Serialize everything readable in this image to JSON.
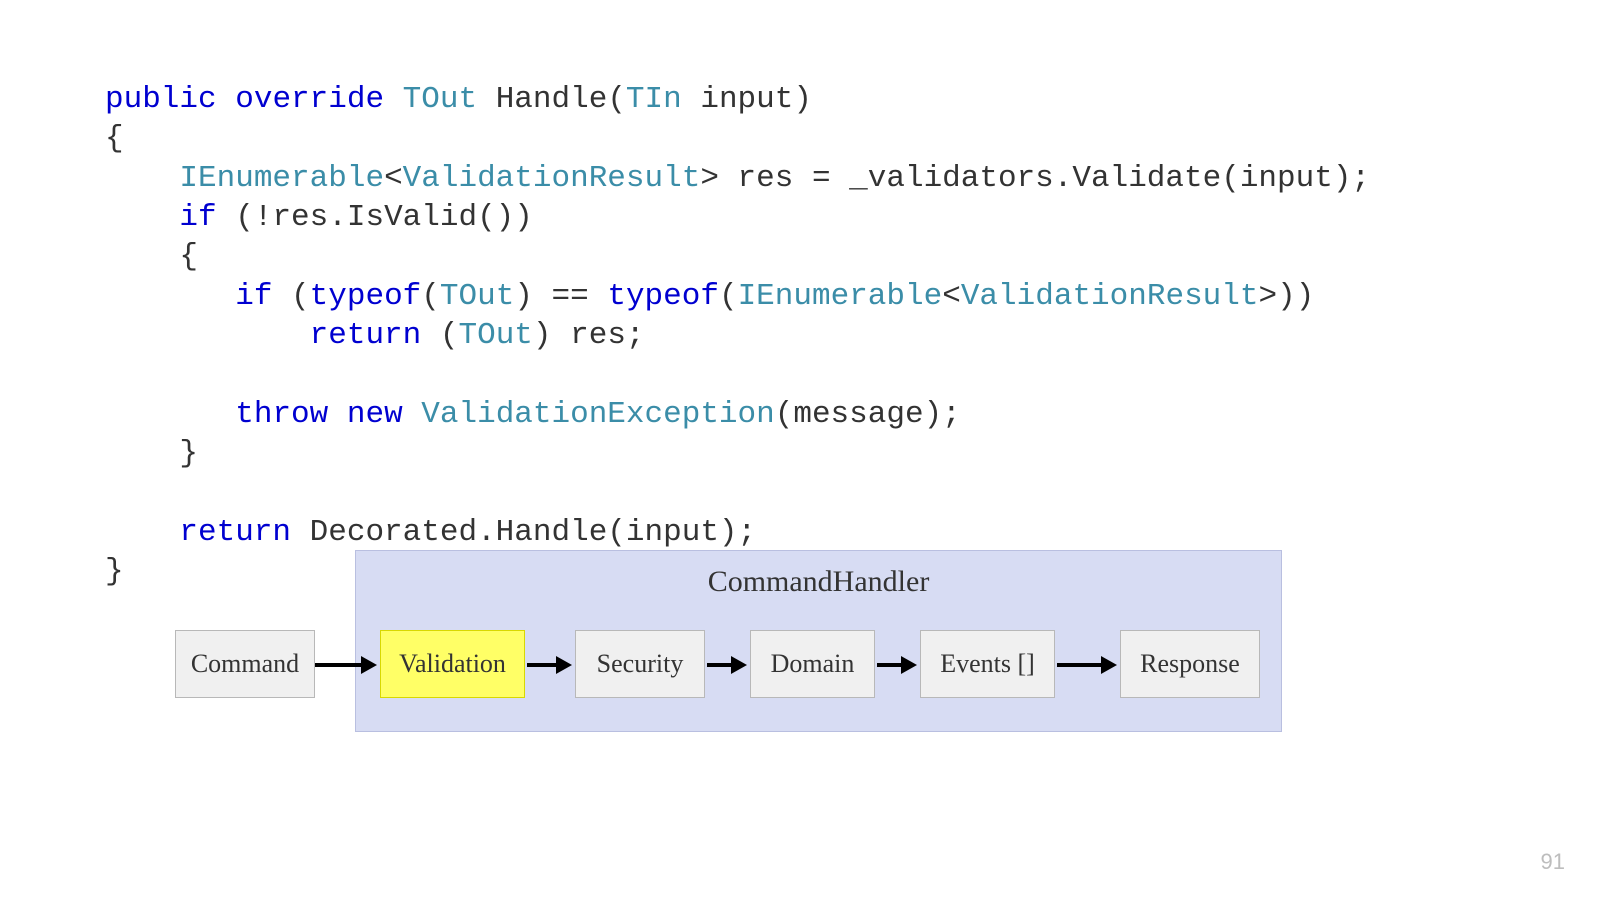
{
  "code": {
    "line1_a": "public",
    "line1_b": " ",
    "line1_c": "override",
    "line1_d": " ",
    "line1_e": "TOut",
    "line1_f": " Handle(",
    "line1_g": "TIn",
    "line1_h": " input)",
    "line2": "{",
    "line3_a": "    ",
    "line3_b": "IEnumerable",
    "line3_c": "<",
    "line3_d": "ValidationResult",
    "line3_e": "> res = _validators.Validate(input);",
    "line4_a": "    ",
    "line4_b": "if",
    "line4_c": " (!res.IsValid())",
    "line5": "    {",
    "line6_a": "       ",
    "line6_b": "if",
    "line6_c": " (",
    "line6_d": "typeof",
    "line6_e": "(",
    "line6_f": "TOut",
    "line6_g": ") == ",
    "line6_h": "typeof",
    "line6_i": "(",
    "line6_j": "IEnumerable",
    "line6_k": "<",
    "line6_l": "ValidationResult",
    "line6_m": ">))",
    "line7_a": "           ",
    "line7_b": "return",
    "line7_c": " (",
    "line7_d": "TOut",
    "line7_e": ") res;",
    "line8": "",
    "line9_a": "       ",
    "line9_b": "throw",
    "line9_c": " ",
    "line9_d": "new",
    "line9_e": " ",
    "line9_f": "ValidationException",
    "line9_g": "(message);",
    "line10": "    }",
    "line11": "",
    "line12_a": "    ",
    "line12_b": "return",
    "line12_c": " Decorated.Handle(input);",
    "line13": "}"
  },
  "diagram": {
    "title": "CommandHandler",
    "nodes": {
      "command": "Command",
      "validation": "Validation",
      "security": "Security",
      "domain": "Domain",
      "events": "Events []",
      "response": "Response"
    }
  },
  "page_number": "91"
}
